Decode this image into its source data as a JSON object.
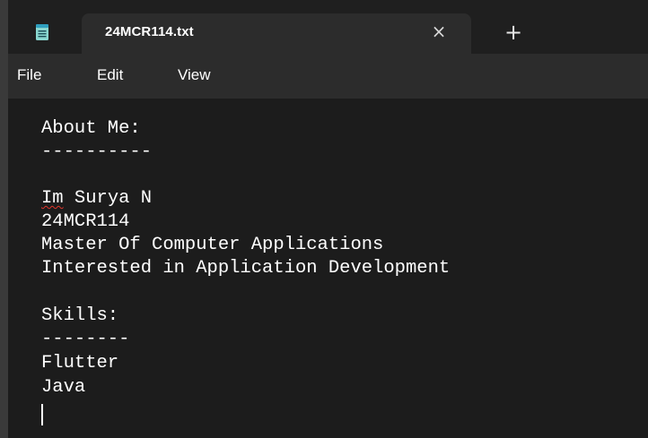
{
  "window": {
    "tab_title": "24MCR114.txt",
    "close_tab_glyph": "×",
    "new_tab_glyph": "+",
    "app_icon": "notepad-icon"
  },
  "menu": {
    "file": "File",
    "edit": "Edit",
    "view": "View"
  },
  "document": {
    "lines": [
      "About Me:",
      "----------",
      "",
      "Im Surya N",
      "24MCR114",
      "Master Of Computer Applications",
      "Interested in Application Development",
      "",
      "Skills:",
      "--------",
      "Flutter",
      "Java"
    ],
    "misspelled_word": "Im",
    "line_3_rest": " Surya N"
  },
  "colors": {
    "background": "#1c1c1c",
    "menubar": "#2c2c2c",
    "text": "#ffffff",
    "spellcheck": "#e0352b",
    "icon_accent": "#8ad7d0"
  }
}
